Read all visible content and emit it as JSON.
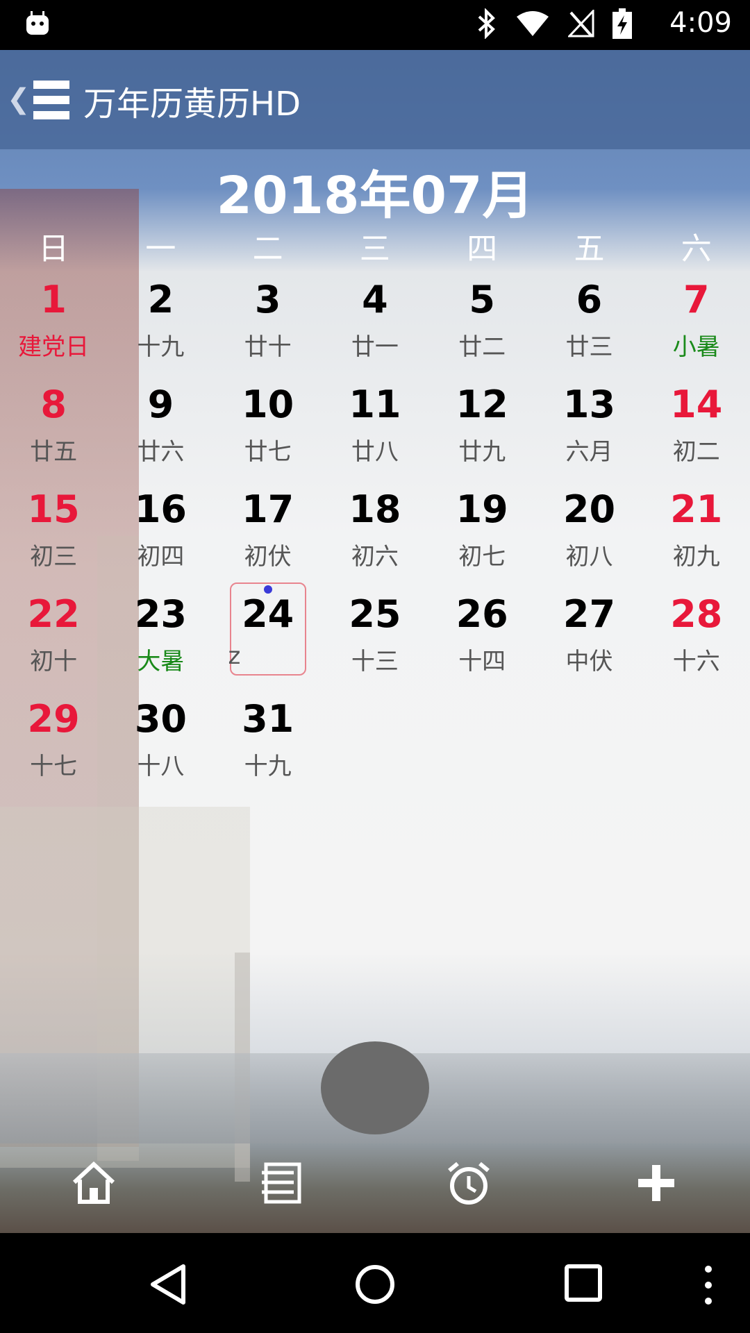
{
  "status_bar": {
    "time": "4:09"
  },
  "app": {
    "title": "万年历黄历HD",
    "month_title": "2018年07月"
  },
  "weekdays": [
    "日",
    "一",
    "二",
    "三",
    "四",
    "五",
    "六"
  ],
  "calendar": {
    "today": "24",
    "days": [
      {
        "n": "1",
        "s": "建党日",
        "weekend": true,
        "sub_color": "red"
      },
      {
        "n": "2",
        "s": "十九"
      },
      {
        "n": "3",
        "s": "廿十"
      },
      {
        "n": "4",
        "s": "廿一"
      },
      {
        "n": "5",
        "s": "廿二"
      },
      {
        "n": "6",
        "s": "廿三"
      },
      {
        "n": "7",
        "s": "小暑",
        "weekend": true,
        "sub_color": "green"
      },
      {
        "n": "8",
        "s": "廿五",
        "weekend": true
      },
      {
        "n": "9",
        "s": "廿六"
      },
      {
        "n": "10",
        "s": "廿七"
      },
      {
        "n": "11",
        "s": "廿八"
      },
      {
        "n": "12",
        "s": "廿九"
      },
      {
        "n": "13",
        "s": "六月"
      },
      {
        "n": "14",
        "s": "初二",
        "weekend": true
      },
      {
        "n": "15",
        "s": "初三",
        "weekend": true
      },
      {
        "n": "16",
        "s": "初四"
      },
      {
        "n": "17",
        "s": "初伏"
      },
      {
        "n": "18",
        "s": "初六"
      },
      {
        "n": "19",
        "s": "初七"
      },
      {
        "n": "20",
        "s": "初八"
      },
      {
        "n": "21",
        "s": "初九",
        "weekend": true
      },
      {
        "n": "22",
        "s": "初十",
        "weekend": true
      },
      {
        "n": "23",
        "s": "大暑",
        "sub_color": "green"
      },
      {
        "n": "24",
        "s": "z",
        "today": true
      },
      {
        "n": "25",
        "s": "十三"
      },
      {
        "n": "26",
        "s": "十四"
      },
      {
        "n": "27",
        "s": "中伏"
      },
      {
        "n": "28",
        "s": "十六",
        "weekend": true
      },
      {
        "n": "29",
        "s": "十七",
        "weekend": true
      },
      {
        "n": "30",
        "s": "十八"
      },
      {
        "n": "31",
        "s": "十九"
      }
    ]
  },
  "colors": {
    "weekend": "#e8183a",
    "festival_green": "#1a8a1a",
    "today_border": "#e8848e"
  },
  "bottom_tabs": [
    "home-icon",
    "list-icon",
    "alarm-icon",
    "add-icon"
  ],
  "nav_bar": [
    "back-icon",
    "home-circle-icon",
    "recents-icon",
    "more-icon"
  ]
}
